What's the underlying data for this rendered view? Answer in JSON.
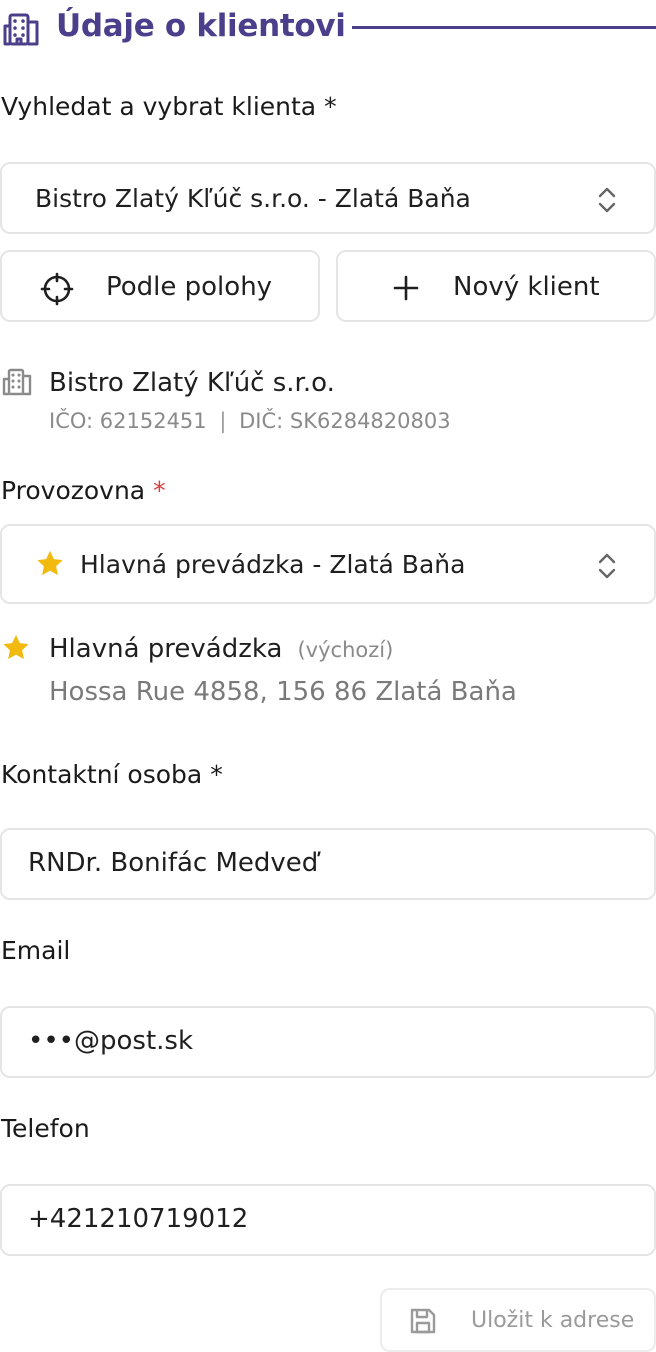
{
  "section": {
    "title": "Údaje o klientovi",
    "icon": "building-icon",
    "accent_color": "#4b3f8c"
  },
  "client_search": {
    "label": "Vyhledat a vybrat klienta",
    "required_mark": "*",
    "selected_value": "Bistro Zlatý Kľúč s.r.o. - Zlatá Baňa"
  },
  "actions": {
    "by_location_label": "Podle polohy",
    "new_client_label": "Nový klient"
  },
  "client_info": {
    "name": "Bistro Zlatý Kľúč s.r.o.",
    "ico": "IČO: 62152451",
    "separator": "|",
    "dic": "DIČ: SK6284820803"
  },
  "establishment": {
    "label": "Provozovna",
    "required_mark": "*",
    "selected_value": "Hlavná prevádzka - Zlatá Baňa",
    "star_color": "#f2b90f"
  },
  "establishment_info": {
    "name": "Hlavná prevádzka",
    "default_tag": "(výchozí)",
    "address": "Hossa Rue 4858, 156 86 Zlatá Baňa"
  },
  "contact_person": {
    "label": "Kontaktní osoba",
    "required_mark": "*",
    "value": "RNDr. Bonifác Medveď"
  },
  "email": {
    "label": "Email",
    "value": "•••@post.sk"
  },
  "phone": {
    "label": "Telefon",
    "value": "+421210719012"
  },
  "save": {
    "label": "Uložit k adrese"
  }
}
